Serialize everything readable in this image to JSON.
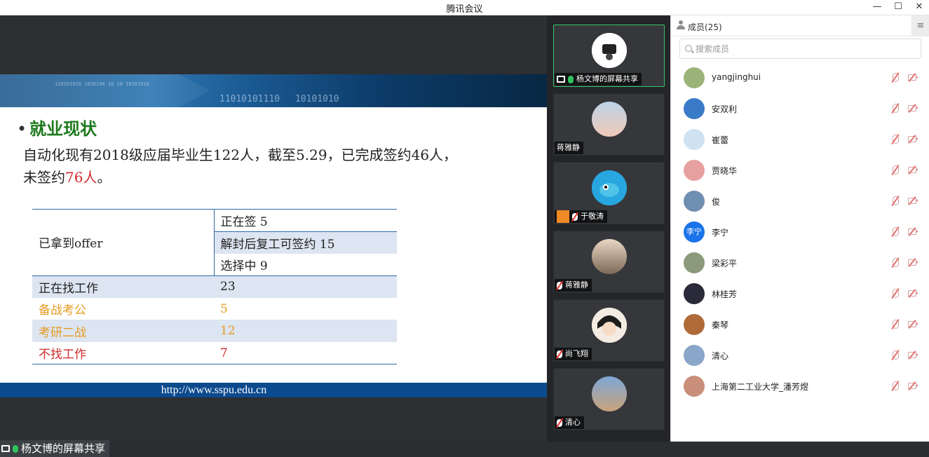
{
  "window": {
    "title": "腾讯会议",
    "minimize": "—",
    "maximize": "☐",
    "close": "✕"
  },
  "slide": {
    "banner_binary_1": "11010101110",
    "banner_binary_2": "10101010",
    "banner_binary_small": "110101010  1010100  10  10 10101010",
    "heading_bullet": "•",
    "heading": "就业现状",
    "para_line1": "自动化现有2018级应届毕业生122人，截至5.29，已完成签约46人，",
    "para_line2_prefix": "未签约",
    "para_line2_red": "76人",
    "para_line2_suffix": "。",
    "table": {
      "offer_label": "已拿到offer",
      "offer_sub": [
        {
          "label": "正在签 5"
        },
        {
          "label": "解封后复工可签约 15"
        },
        {
          "label": "选择中 9"
        }
      ],
      "rows": [
        {
          "label": "正在找工作",
          "value": "23"
        },
        {
          "label": "备战考公",
          "value": "5"
        },
        {
          "label": "考研二战",
          "value": "12"
        },
        {
          "label": "不找工作",
          "value": "7"
        }
      ]
    },
    "footer_url": "http://www.sspu.edu.cn"
  },
  "share_label": "杨文博的屏幕共享",
  "video_tiles": [
    {
      "name": "杨文博的屏幕共享",
      "mic": "on"
    },
    {
      "name": "蒋雅静",
      "mic": "none"
    },
    {
      "name": "于敬涛",
      "mic": "off"
    },
    {
      "name": "蒋雅静",
      "mic": "off"
    },
    {
      "name": "尚飞翔",
      "mic": "off"
    },
    {
      "name": "清心",
      "mic": "off"
    }
  ],
  "members": {
    "header": "成员(25)",
    "menu_icon": "≡",
    "search_placeholder": "搜索成员",
    "list": [
      {
        "name": "yangjinghui",
        "avatar_color": "#9cb37a"
      },
      {
        "name": "安双利",
        "avatar_color": "#3a7bc8"
      },
      {
        "name": "崔蕾",
        "avatar_color": "#cfe2f2"
      },
      {
        "name": "贾晓华",
        "avatar_color": "#e7a0a0"
      },
      {
        "name": "俊",
        "avatar_color": "#6f8fb0"
      },
      {
        "name": "李宁",
        "avatar_color": "#1a73e8",
        "avatar_text": "李宁"
      },
      {
        "name": "梁彩平",
        "avatar_color": "#8a9a7a"
      },
      {
        "name": "林桂芳",
        "avatar_color": "#2a2a3a"
      },
      {
        "name": "秦琴",
        "avatar_color": "#b06a3a"
      },
      {
        "name": "清心",
        "avatar_color": "#8aa6c8"
      },
      {
        "name": "上海第二工业大学_潘芳煜",
        "avatar_color": "#c98f7a"
      }
    ]
  }
}
